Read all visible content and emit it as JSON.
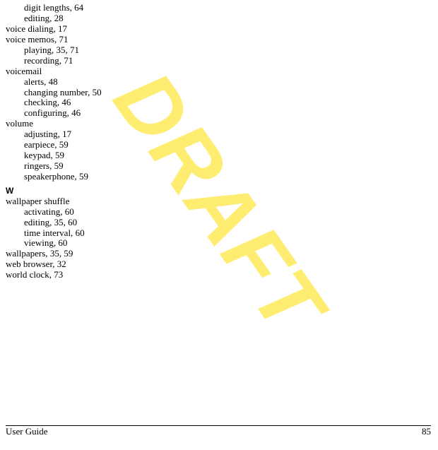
{
  "watermark": "DRAFT",
  "footer": {
    "left": "User Guide",
    "right": "85"
  },
  "entries": [
    {
      "level": "sub",
      "text": "digit lengths,",
      "page": "64"
    },
    {
      "level": "sub",
      "text": "editing,",
      "page": "28"
    },
    {
      "level": "main",
      "text": "voice dialing,",
      "page": "17"
    },
    {
      "level": "main",
      "text": "voice memos,",
      "page": "71"
    },
    {
      "level": "sub",
      "text": "playing,",
      "page": "35, 71"
    },
    {
      "level": "sub",
      "text": "recording,",
      "page": "71"
    },
    {
      "level": "main",
      "text": "voicemail",
      "page": ""
    },
    {
      "level": "sub",
      "text": "alerts,",
      "page": "48"
    },
    {
      "level": "sub",
      "text": "changing number,",
      "page": "50"
    },
    {
      "level": "sub",
      "text": "checking,",
      "page": "46"
    },
    {
      "level": "sub",
      "text": "configuring,",
      "page": "46"
    },
    {
      "level": "main",
      "text": "volume",
      "page": ""
    },
    {
      "level": "sub",
      "text": "adjusting,",
      "page": "17"
    },
    {
      "level": "sub",
      "text": "earpiece,",
      "page": "59"
    },
    {
      "level": "sub",
      "text": "keypad,",
      "page": "59"
    },
    {
      "level": "sub",
      "text": "ringers,",
      "page": "59"
    },
    {
      "level": "sub",
      "text": "speakerphone,",
      "page": "59"
    },
    {
      "level": "letter",
      "text": "W",
      "page": ""
    },
    {
      "level": "main",
      "text": "wallpaper shuffle",
      "page": ""
    },
    {
      "level": "sub",
      "text": "activating,",
      "page": "60"
    },
    {
      "level": "sub",
      "text": "editing,",
      "page": "35, 60"
    },
    {
      "level": "sub",
      "text": "time interval,",
      "page": "60"
    },
    {
      "level": "sub",
      "text": "viewing,",
      "page": "60"
    },
    {
      "level": "main",
      "text": "wallpapers,",
      "page": "35, 59"
    },
    {
      "level": "main",
      "text": "web browser,",
      "page": "32"
    },
    {
      "level": "main",
      "text": "world clock,",
      "page": "73"
    }
  ]
}
